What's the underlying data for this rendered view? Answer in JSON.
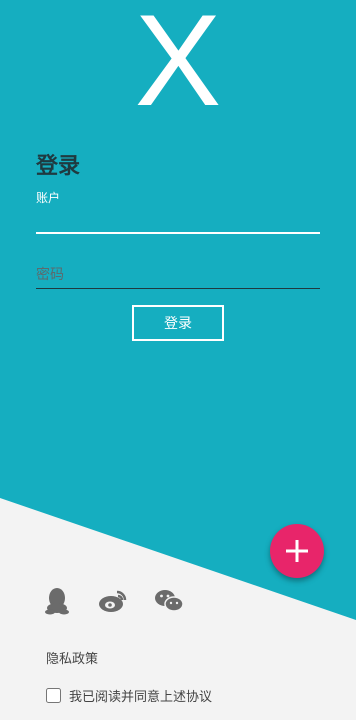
{
  "logo": {
    "text": "X"
  },
  "login_form": {
    "title": "登录",
    "account_label": "账户",
    "account_value": "",
    "password_placeholder": "密码",
    "password_value": "",
    "submit_label": "登录"
  },
  "fab": {
    "icon": "plus-icon",
    "color": "#e8256a"
  },
  "social_login": [
    {
      "icon": "qq-icon"
    },
    {
      "icon": "weibo-icon"
    },
    {
      "icon": "wechat-icon"
    }
  ],
  "privacy_link": "隐私政策",
  "agreement": {
    "label": "我已阅读并同意上述协议",
    "checked": false
  },
  "colors": {
    "primary": "#15aec0",
    "accent": "#e8256a",
    "background": "#f3f3f3"
  }
}
